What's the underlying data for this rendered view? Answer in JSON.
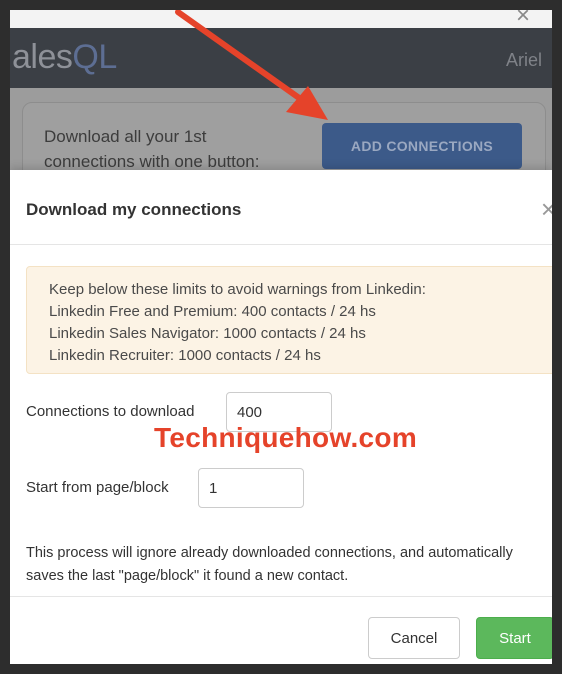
{
  "background": {
    "logo": {
      "prefix": "ales",
      "suffix": "QL"
    },
    "username": "Ariel",
    "card_text": "Download all your 1st connections with one button:",
    "add_button_label": "ADD CONNECTIONS"
  },
  "modal": {
    "title": "Download my connections",
    "close_icon": "×",
    "warning_lines": [
      "Keep below these limits to avoid warnings from Linkedin:",
      "Linkedin Free and Premium: 400 contacts / 24 hs",
      "Linkedin Sales Navigator: 1000 contacts / 24 hs",
      "Linkedin Recruiter: 1000 contacts / 24 hs"
    ],
    "connections_label": "Connections to download",
    "connections_value": "400",
    "start_label": "Start from page/block",
    "start_value": "1",
    "info_text": "This process will ignore already downloaded connections, and automatically saves the last \"page/block\" it found a new contact.",
    "cancel_label": "Cancel",
    "start_button_label": "Start"
  },
  "watermark": "Techniquehow.com",
  "colors": {
    "accent_arrow": "#e5432a",
    "start_button": "#5cb85c",
    "warning_bg": "#fcf3e5"
  }
}
